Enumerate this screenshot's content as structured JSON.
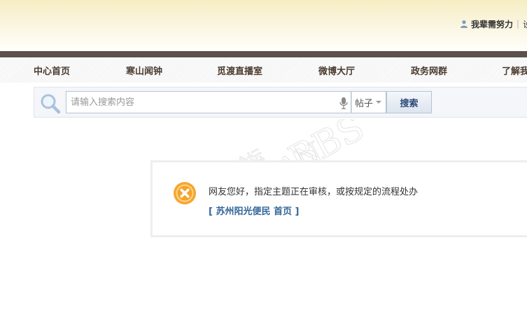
{
  "header": {
    "user_name": "我辈需努力",
    "user_next": "设"
  },
  "nav": {
    "items": [
      {
        "label": "中心首页"
      },
      {
        "label": "寒山闻钟"
      },
      {
        "label": "觅渡直播室"
      },
      {
        "label": "微博大厅"
      },
      {
        "label": "政务网群"
      },
      {
        "label": "了解我"
      }
    ]
  },
  "search": {
    "placeholder": "请输入搜索内容",
    "type_value": "帖子",
    "button_label": "搜索"
  },
  "message": {
    "text": "网友您好，指定主题正在审核，或按规定的流程处办",
    "link_text": "[ 苏州阳光便民 首页 ]"
  },
  "watermark": {
    "text": "寒山论坛 KONSHANBBS"
  },
  "colors": {
    "dark_bar": "#5c514b",
    "nav_text": "#4a3b2f",
    "link": "#336699",
    "error_orange": "#f5a623"
  }
}
